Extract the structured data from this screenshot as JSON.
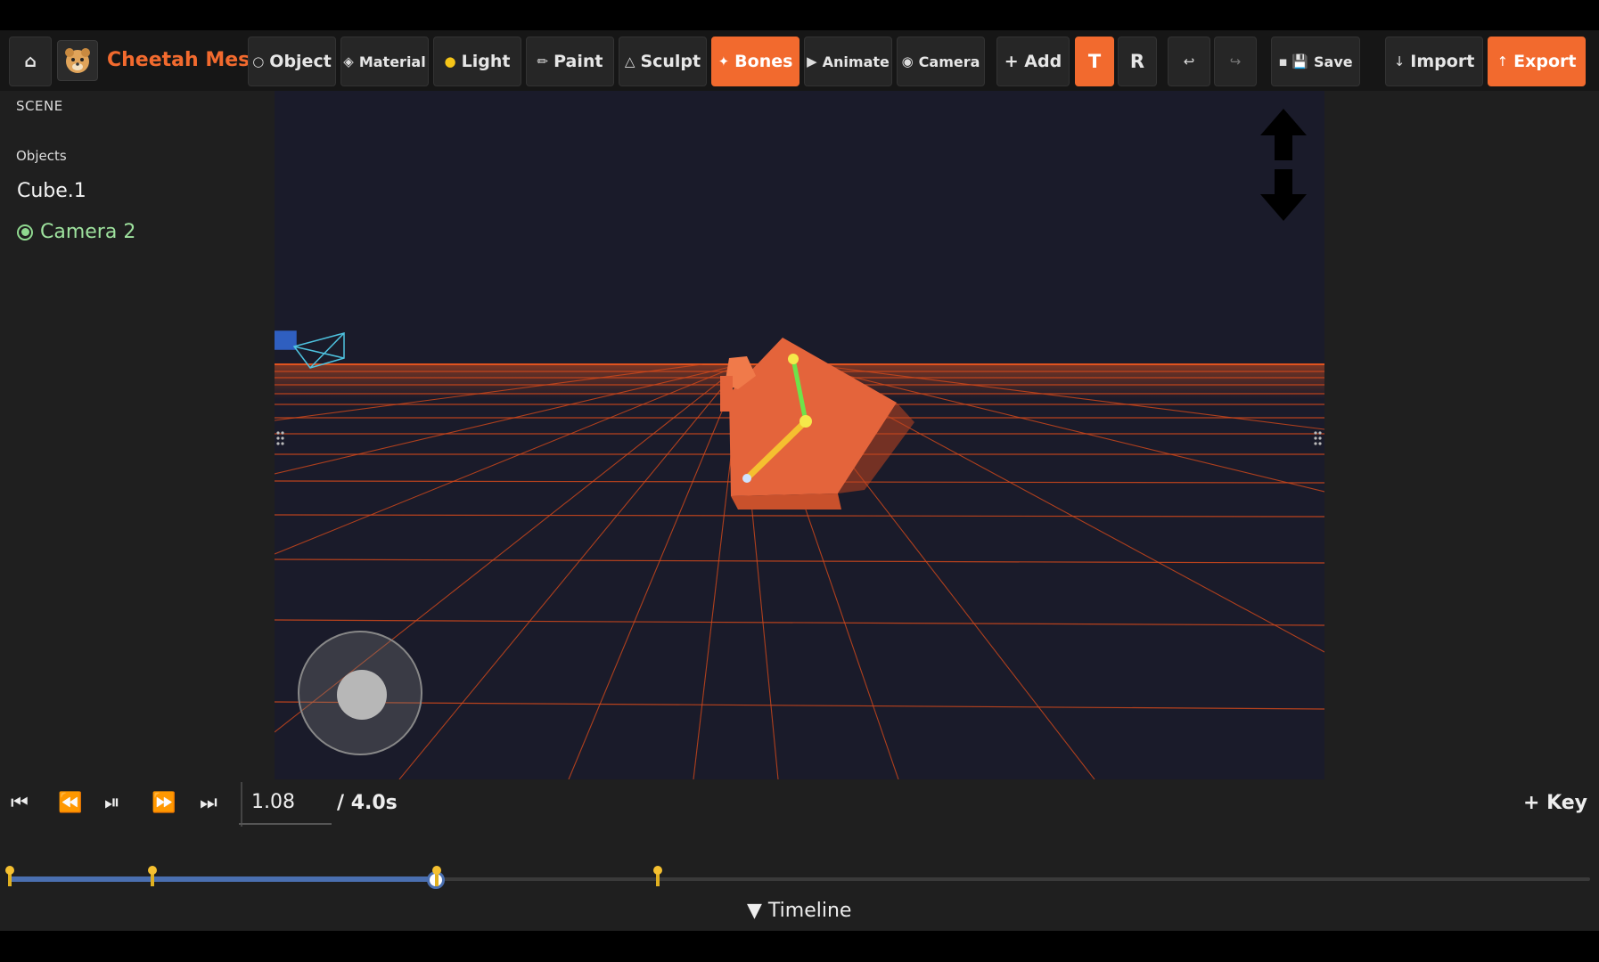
{
  "app": {
    "title": "Cheetah Mesh"
  },
  "toolbar": {
    "home_icon": "⌂",
    "object_label": "Object",
    "material_label": "Material",
    "light_label": "Light",
    "paint_label": "Paint",
    "sculpt_label": "Sculpt",
    "bones_label": "Bones",
    "animate_label": "Animate",
    "camera_label": "Camera",
    "add_label": "+ Add",
    "translate_label": "T",
    "rotate_label": "R",
    "undo_icon": "↩",
    "redo_icon": "↪",
    "save_label": "Save",
    "import_label": "Import",
    "export_label": "Export",
    "active_tool": "Bones",
    "active_transform": "T"
  },
  "scene": {
    "header": "SCENE",
    "objects_header": "Objects",
    "objects": [
      {
        "name": "Cube.1",
        "selected": false
      },
      {
        "name": "Camera 2",
        "selected": true
      }
    ]
  },
  "timeline": {
    "current_time": "1.08",
    "total_time": "/ 4.0s",
    "add_key_label": "+ Key",
    "toggle_label": "▼ Timeline",
    "progress": 0.27,
    "keyframes": [
      0.0,
      0.09,
      0.27,
      0.41
    ]
  },
  "colors": {
    "accent": "#f26a2e",
    "grid": "#e0531f",
    "selected": "#9ee29e",
    "track_fill": "#4a6fb0",
    "keyframe": "#f5c030"
  }
}
